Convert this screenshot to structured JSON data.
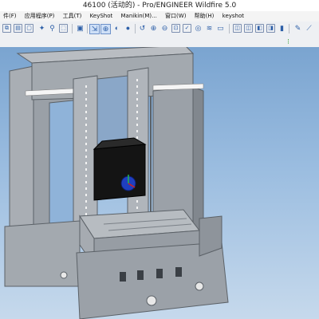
{
  "window": {
    "title": "46100 (活动的) - Pro/ENGINEER Wildfire 5.0"
  },
  "menu": {
    "items": [
      "件(F)",
      "应用程序(P)",
      "工具(T)",
      "KeyShot",
      "Manikin(M)...",
      "窗口(W)",
      "帮助(H)",
      "keyshot"
    ]
  },
  "toolbar": {
    "icons": [
      "copy-icon",
      "paste-icon",
      "page-icon",
      "regenerate-icon",
      "find-icon",
      "select-box-icon",
      "repaint-icon",
      "orient-icon",
      "spin-center-icon",
      "shading-icon",
      "named-views-icon",
      "zoom-in-icon",
      "zoom-out-icon",
      "refit-icon",
      "datum-plane-icon",
      "datum-axis-icon",
      "datum-point-icon",
      "coord-sys-icon",
      "window-icon",
      "view-icon",
      "layer-icon",
      "sketch-icon",
      "annotation-icon",
      "model-tree-icon",
      "feature-icon"
    ]
  },
  "viewport": {
    "content": "3d-machine-model"
  },
  "colors": {
    "background_top": "#7aa4d0",
    "background_bottom": "#c6d9ec",
    "model_gray": "#8e949b",
    "head_black": "#141414",
    "accent_blue": "#1f3fc0"
  }
}
